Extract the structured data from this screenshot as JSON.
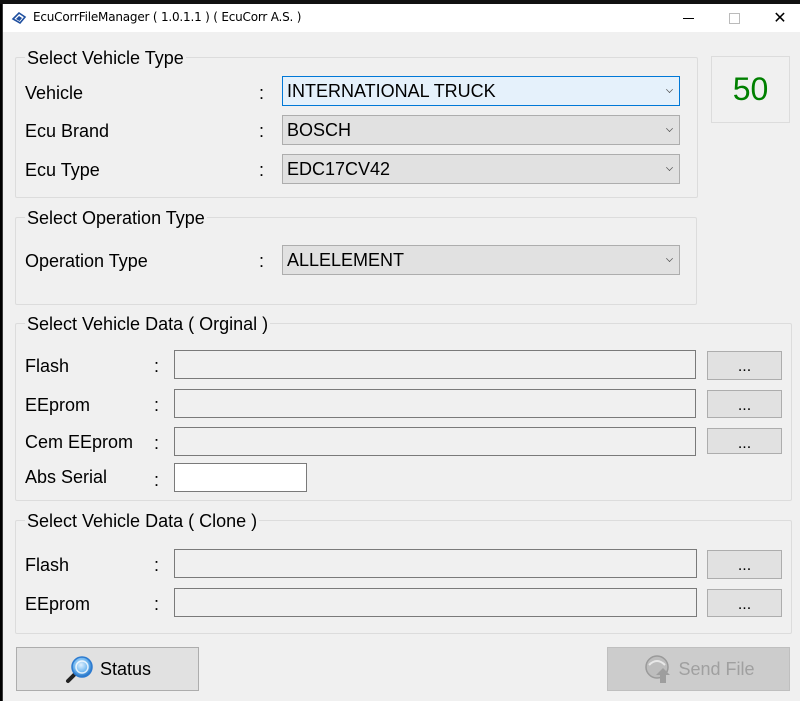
{
  "window": {
    "title": "EcuCorrFileManager ( 1.0.1.1 ) ( EcuCorr A.S. )",
    "controls": {
      "minimize": "minimize",
      "maximize": "maximize",
      "close": "✕"
    }
  },
  "counter": {
    "value": "50",
    "color": "#008000"
  },
  "vehicle_type": {
    "title": "Select Vehicle Type",
    "rows": [
      {
        "label": "Vehicle",
        "colon": ":",
        "value": "INTERNATIONAL TRUCK"
      },
      {
        "label": "Ecu Brand",
        "colon": ":",
        "value": "BOSCH"
      },
      {
        "label": "Ecu Type",
        "colon": ":",
        "value": "EDC17CV42"
      }
    ]
  },
  "operation_type": {
    "title": "Select Operation Type",
    "label": "Operation Type",
    "colon": ":",
    "value": "ALLELEMENT"
  },
  "original_data": {
    "title": "Select Vehicle Data ( Orginal )",
    "rows": [
      {
        "label": "Flash",
        "colon": ":",
        "value": "",
        "browse": "..."
      },
      {
        "label": "EEprom",
        "colon": ":",
        "value": "",
        "browse": "..."
      },
      {
        "label": "Cem EEprom",
        "colon": ":",
        "value": "",
        "browse": "..."
      },
      {
        "label": "Abs Serial",
        "colon": ":",
        "value": ""
      }
    ]
  },
  "clone_data": {
    "title": "Select Vehicle Data ( Clone )",
    "rows": [
      {
        "label": "Flash",
        "colon": ":",
        "value": "",
        "browse": "..."
      },
      {
        "label": "EEprom",
        "colon": ":",
        "value": "",
        "browse": "..."
      }
    ]
  },
  "buttons": {
    "status": {
      "label": "Status",
      "icon": "magnifier-icon"
    },
    "send_file": {
      "label": "Send File",
      "icon": "upload-globe-icon",
      "enabled": false
    }
  }
}
